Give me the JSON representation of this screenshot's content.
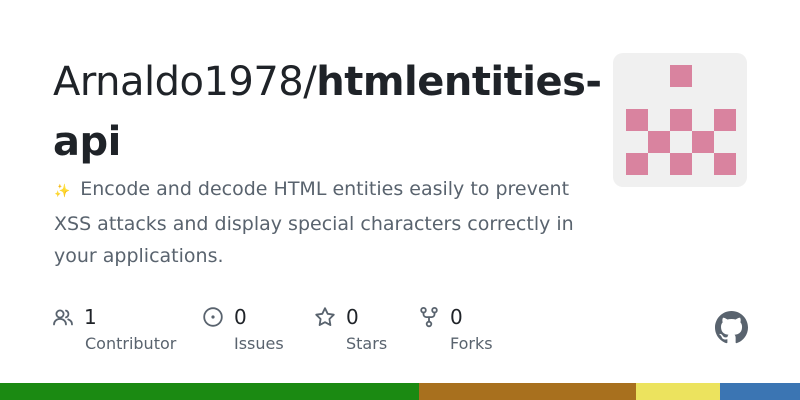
{
  "repo": {
    "owner": "Arnaldo1978/",
    "name_line1": "htmlentities-",
    "name_line2": "api",
    "description_emoji": "✨",
    "description": "Encode and decode HTML entities easily to prevent XSS attacks and display special characters correctly in your applications."
  },
  "stats": [
    {
      "icon": "people-icon",
      "count": "1",
      "label": "Contributor"
    },
    {
      "icon": "issue-opened-icon",
      "count": "0",
      "label": "Issues"
    },
    {
      "icon": "star-icon",
      "count": "0",
      "label": "Stars"
    },
    {
      "icon": "fork-icon",
      "count": "0",
      "label": "Forks"
    }
  ],
  "colors": {
    "title": "#1f2328",
    "muted": "#59636e",
    "avatar_bg": "#f0f0f0",
    "avatar_fg": "#d9839f"
  },
  "languages": [
    {
      "share": 0.524,
      "color": "#1b8a12"
    },
    {
      "share": 0.271,
      "color": "#a8701e"
    },
    {
      "share": 0.105,
      "color": "#ece35e"
    },
    {
      "share": 0.1,
      "color": "#3b75b3"
    }
  ]
}
